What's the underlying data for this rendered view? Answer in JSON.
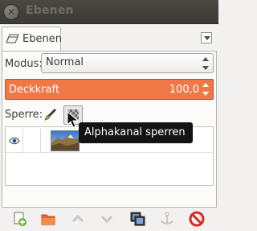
{
  "window": {
    "title": "Ebenen"
  },
  "tab": {
    "label": "Ebenen"
  },
  "mode": {
    "label": "Modus:",
    "value": "Normal"
  },
  "opacity": {
    "label": "Deckkraft",
    "value": "100,0"
  },
  "lock": {
    "label": "Sperre:"
  },
  "tooltip": {
    "text": "Alphakanal sperren"
  },
  "colors": {
    "accent": "#f07746",
    "titlebar": "#3c3b37",
    "delete": "#d62b22"
  },
  "toolbar_icons": [
    "new-layer-icon",
    "new-layer-group-icon",
    "raise-layer-icon",
    "lower-layer-icon",
    "duplicate-layer-icon",
    "anchor-layer-icon",
    "delete-layer-icon"
  ]
}
